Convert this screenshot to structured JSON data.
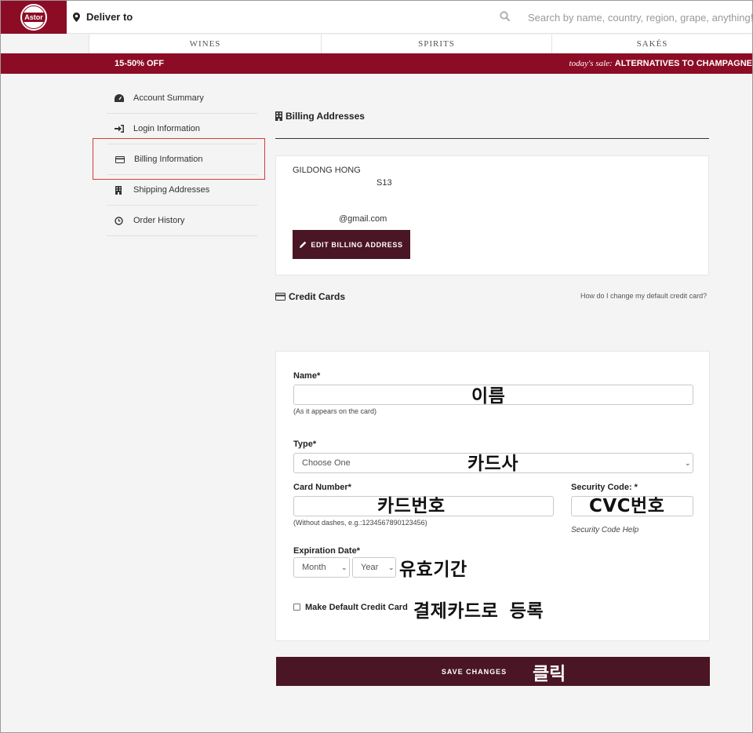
{
  "header": {
    "logo_text": "Astor",
    "deliver_label": "Deliver to",
    "search_placeholder": "Search by name, country, region, grape, anything!"
  },
  "nav": {
    "items": [
      "WINES",
      "SPIRITS",
      "SAKÉS"
    ]
  },
  "sale_bar": {
    "left": "15-50% OFF",
    "right_prefix": "today's sale:",
    "right_text": "ALTERNATIVES TO CHAMPAGNE"
  },
  "sidebar": {
    "items": [
      {
        "label": "Account Summary",
        "icon": "dashboard-icon"
      },
      {
        "label": "Login Information",
        "icon": "sign-in-icon"
      },
      {
        "label": "Billing Information",
        "icon": "credit-card-icon"
      },
      {
        "label": "Shipping Addresses",
        "icon": "building-icon"
      },
      {
        "label": "Order History",
        "icon": "clock-icon"
      }
    ],
    "highlighted": "Billing Information",
    "highlight_color": "#d93a3a"
  },
  "billing": {
    "title": "Billing Addresses",
    "name": "GILDONG HONG",
    "line2": "S13",
    "email": "@gmail.com",
    "edit_button": "EDIT BILLING ADDRESS"
  },
  "credit_cards": {
    "title": "Credit Cards",
    "help_link": "How do I change my default credit card?"
  },
  "form": {
    "name_label": "Name*",
    "name_value": "",
    "name_hint": "(As it appears on the card)",
    "type_label": "Type*",
    "type_selected": "Choose One",
    "card_number_label": "Card Number*",
    "card_number_value": "",
    "card_number_hint": "(Without dashes, e.g.:1234567890123456)",
    "security_label": "Security Code: *",
    "security_value": "",
    "security_help": "Security Code Help",
    "expiration_label": "Expiration Date*",
    "month_selected": "Month",
    "year_selected": "Year",
    "default_label": "Make Default Credit Card",
    "save_button": "SAVE CHANGES"
  },
  "annotations": {
    "name": "이름",
    "type": "카드사",
    "card_number": "카드번호",
    "security": "CVC번호",
    "expiration": "유효기간",
    "default_card": "결제카드로 등록",
    "save": "클릭"
  },
  "colors": {
    "brand": "#8d0c25",
    "button_dark": "#4a1524"
  }
}
